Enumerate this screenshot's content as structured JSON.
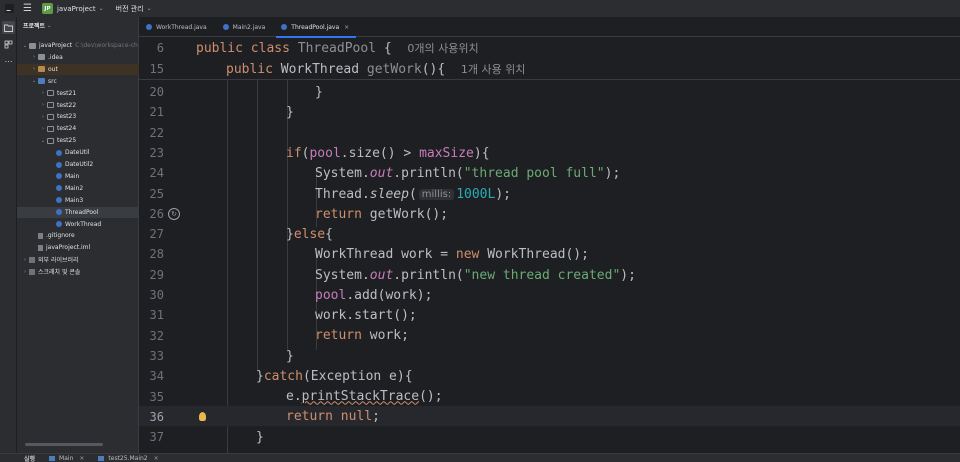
{
  "titlebar": {
    "project_badge": "JP",
    "project_name": "javaProject",
    "vcs_label": "버전 관리"
  },
  "project_panel": {
    "header": "프로젝트",
    "tree": [
      {
        "label": "javaProject",
        "path": "C:\\dev\\workspace-ch",
        "depth": 0,
        "icon": "folder",
        "expanded": true
      },
      {
        "label": ".idea",
        "depth": 1,
        "icon": "folder",
        "expanded": false
      },
      {
        "label": "out",
        "depth": 1,
        "icon": "folder-orange",
        "expanded": false
      },
      {
        "label": "src",
        "depth": 1,
        "icon": "folder-src",
        "expanded": true
      },
      {
        "label": "test21",
        "depth": 2,
        "icon": "package",
        "expanded": false
      },
      {
        "label": "test22",
        "depth": 2,
        "icon": "package",
        "expanded": false
      },
      {
        "label": "test23",
        "depth": 2,
        "icon": "package",
        "expanded": false
      },
      {
        "label": "test24",
        "depth": 2,
        "icon": "package",
        "expanded": false
      },
      {
        "label": "test25",
        "depth": 2,
        "icon": "package",
        "expanded": true
      },
      {
        "label": "DateUtil",
        "depth": 3,
        "icon": "class"
      },
      {
        "label": "DateUtil2",
        "depth": 3,
        "icon": "class"
      },
      {
        "label": "Main",
        "depth": 3,
        "icon": "class"
      },
      {
        "label": "Main2",
        "depth": 3,
        "icon": "class"
      },
      {
        "label": "Main3",
        "depth": 3,
        "icon": "class"
      },
      {
        "label": "ThreadPool",
        "depth": 3,
        "icon": "class",
        "selected": true
      },
      {
        "label": "WorkThread",
        "depth": 3,
        "icon": "class"
      },
      {
        "label": ".gitignore",
        "depth": 1,
        "icon": "file"
      },
      {
        "label": "javaProject.iml",
        "depth": 1,
        "icon": "file"
      },
      {
        "label": "외부 라이브러리",
        "depth": 0,
        "icon": "library",
        "expanded": false
      },
      {
        "label": "스크래치 및 콘솔",
        "depth": 0,
        "icon": "library",
        "expanded": false
      }
    ]
  },
  "tabs": [
    {
      "label": "WorkThread.java",
      "active": false
    },
    {
      "label": "Main2.java",
      "active": false
    },
    {
      "label": "ThreadPool.java",
      "active": true,
      "close": "×"
    }
  ],
  "editor": {
    "sticky_lines": [
      {
        "num": "6",
        "hint": "0개의 사용위치"
      },
      {
        "num": "15",
        "hint": "1개 사용 위치"
      }
    ],
    "line_numbers": [
      "20",
      "21",
      "22",
      "23",
      "24",
      "25",
      "26",
      "27",
      "28",
      "29",
      "30",
      "31",
      "32",
      "33",
      "34",
      "35",
      "36",
      "37"
    ],
    "current_line": "36",
    "inline_hint": "millis:",
    "strings": {
      "full": "\"thread pool full\"",
      "created": "\"new thread created\""
    },
    "number_literal": "1000L"
  },
  "runbar": {
    "label": "실행",
    "tabs": [
      "Main",
      "test25.Main2"
    ]
  }
}
